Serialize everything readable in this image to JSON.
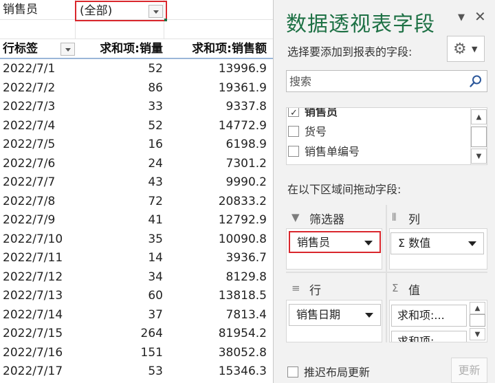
{
  "sheet": {
    "filter_label": "销售员",
    "filter_value": "(全部)",
    "headers": {
      "row_label": "行标签",
      "sum_qty": "求和项:销量",
      "sum_amount": "求和项:销售额"
    },
    "rows": [
      {
        "date": "2022/7/1",
        "qty": "52",
        "amount": "13996.9"
      },
      {
        "date": "2022/7/2",
        "qty": "86",
        "amount": "19361.9"
      },
      {
        "date": "2022/7/3",
        "qty": "33",
        "amount": "9337.8"
      },
      {
        "date": "2022/7/4",
        "qty": "52",
        "amount": "14772.9"
      },
      {
        "date": "2022/7/5",
        "qty": "16",
        "amount": "6198.9"
      },
      {
        "date": "2022/7/6",
        "qty": "24",
        "amount": "7301.2"
      },
      {
        "date": "2022/7/7",
        "qty": "43",
        "amount": "9990.2"
      },
      {
        "date": "2022/7/8",
        "qty": "72",
        "amount": "20833.2"
      },
      {
        "date": "2022/7/9",
        "qty": "41",
        "amount": "12792.9"
      },
      {
        "date": "2022/7/10",
        "qty": "35",
        "amount": "10090.8"
      },
      {
        "date": "2022/7/11",
        "qty": "14",
        "amount": "3936.7"
      },
      {
        "date": "2022/7/12",
        "qty": "34",
        "amount": "8129.8"
      },
      {
        "date": "2022/7/13",
        "qty": "60",
        "amount": "13818.5"
      },
      {
        "date": "2022/7/14",
        "qty": "37",
        "amount": "7813.4"
      },
      {
        "date": "2022/7/15",
        "qty": "264",
        "amount": "81954.2"
      },
      {
        "date": "2022/7/16",
        "qty": "151",
        "amount": "38052.8"
      },
      {
        "date": "2022/7/17",
        "qty": "53",
        "amount": "15346.3"
      }
    ]
  },
  "pane": {
    "title": "数据透视表字段",
    "ctrl_dropdown": "▼",
    "ctrl_close": "✕",
    "choose_fields_label": "选择要添加到报表的字段:",
    "gear_icon": "⚙",
    "gear_arrow": "▼",
    "search_placeholder": "搜索",
    "fields": [
      {
        "label": "销售员",
        "checked": true
      },
      {
        "label": "货号",
        "checked": false
      },
      {
        "label": "销售单编号",
        "checked": false
      }
    ],
    "scroll_up": "▲",
    "scroll_down": "▼",
    "drag_label": "在以下区域间拖动字段:",
    "areas": {
      "filters": {
        "icon": "▼",
        "title": "筛选器",
        "items": [
          "销售员"
        ]
      },
      "columns": {
        "icon": "⦀",
        "title": "列",
        "items": [
          "数值"
        ],
        "item_prefix": "Σ"
      },
      "rows": {
        "icon": "≡",
        "title": "行",
        "items": [
          "销售日期"
        ]
      },
      "values": {
        "icon": "Σ",
        "title": "值",
        "items": [
          "求和项:...",
          "求和项:..."
        ]
      }
    },
    "defer_label": "推迟布局更新",
    "update_label": "更新"
  },
  "colors": {
    "accent_green": "#1e7145",
    "highlight_red": "#d9262c"
  }
}
